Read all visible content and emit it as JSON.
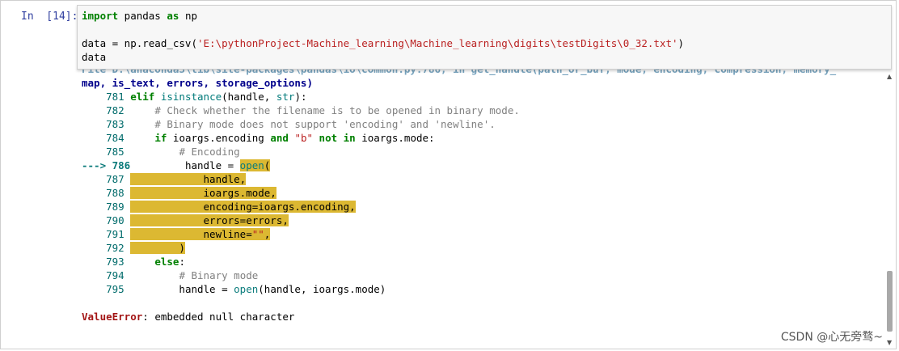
{
  "prompt": "In  [14]:",
  "input": {
    "line1": {
      "kw1": "import",
      "mid": " pandas ",
      "kw2": "as",
      "end": " np"
    },
    "line2": {
      "pre": "data = np.read_csv(",
      "str": "'E:\\pythonProject-Machine_learning\\Machine_learning\\digits\\testDigits\\0_32.txt'",
      "post": ")"
    },
    "line3": "data"
  },
  "traceback": {
    "partial_line": "File D:\\anaconda3\\lib\\site-packages\\pandas\\io\\common.py:786, in get_handle(path_or_buf, mode, encoding, compression, memory_",
    "sig_line": "map, is_text, errors, storage_options)",
    "lines": [
      {
        "num": "781",
        "text": "elif isinstance(handle, str):"
      },
      {
        "num": "782",
        "text": "    # Check whether the filename is to be opened in binary mode."
      },
      {
        "num": "783",
        "text": "    # Binary mode does not support 'encoding' and 'newline'."
      },
      {
        "num": "784",
        "text": "    if ioargs.encoding and \"b\" not in ioargs.mode:"
      },
      {
        "num": "785",
        "text": "        # Encoding"
      },
      {
        "num": "786",
        "text": "        handle = open("
      },
      {
        "num": "787",
        "text": "            handle,"
      },
      {
        "num": "788",
        "text": "            ioargs.mode,"
      },
      {
        "num": "789",
        "text": "            encoding=ioargs.encoding,"
      },
      {
        "num": "790",
        "text": "            errors=errors,"
      },
      {
        "num": "791",
        "text": "            newline=\"\","
      },
      {
        "num": "792",
        "text": "        )"
      },
      {
        "num": "793",
        "text": "    else:"
      },
      {
        "num": "794",
        "text": "        # Binary mode"
      },
      {
        "num": "795",
        "text": "        handle = open(handle, ioargs.mode)"
      }
    ],
    "arrow": "--->",
    "error_type": "ValueError",
    "error_msg": ": embedded null character"
  },
  "watermark": "CSDN @心无旁骛~"
}
